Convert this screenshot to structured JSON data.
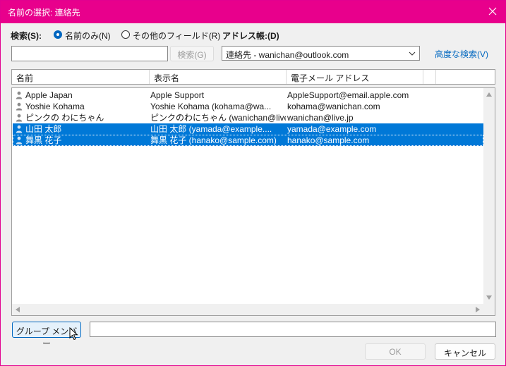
{
  "window": {
    "title": "名前の選択: 連絡先"
  },
  "search": {
    "label": "検索(S):",
    "option_name_only": "名前のみ(N)",
    "option_other_fields": "その他のフィールド(R)",
    "name_only_selected": true,
    "input_value": "",
    "search_button": "検索(G)"
  },
  "address_book": {
    "label": "アドレス帳:(D)",
    "selected": "連絡先 - wanichan@outlook.com",
    "advanced_search": "高度な検索(V)"
  },
  "columns": {
    "name": "名前",
    "display_name": "表示名",
    "email": "電子メール アドレス"
  },
  "rows": [
    {
      "name": "Apple Japan",
      "display_name": "Apple Support",
      "email": "AppleSupport@email.apple.com",
      "selected": false
    },
    {
      "name": "Yoshie Kohama",
      "display_name": "Yoshie Kohama (kohama@wa...",
      "email": "kohama@wanichan.com",
      "selected": false
    },
    {
      "name": "ピンクの わにちゃん",
      "display_name": "ピンクのわにちゃん (wanichan@live....",
      "email": "wanichan@live.jp",
      "selected": false
    },
    {
      "name": "山田 太郎",
      "display_name": "山田 太郎 (yamada@example....",
      "email": "yamada@example.com",
      "selected": true
    },
    {
      "name": "舞黒 花子",
      "display_name": "舞黒 花子 (hanako@sample.com)",
      "email": "hanako@sample.com",
      "selected": true
    }
  ],
  "bottom": {
    "group_members_button": "グループ メンバー",
    "members_field_value": "",
    "ok_button": "OK",
    "cancel_button": "キャンセル"
  },
  "colors": {
    "titlebar": "#e8008c",
    "selection": "#0078d7",
    "accent": "#0067c0"
  },
  "icons": {
    "close": "close-icon",
    "person": "person-icon",
    "dropdown": "chevron-down-icon",
    "cursor": "mouse-pointer-icon"
  }
}
